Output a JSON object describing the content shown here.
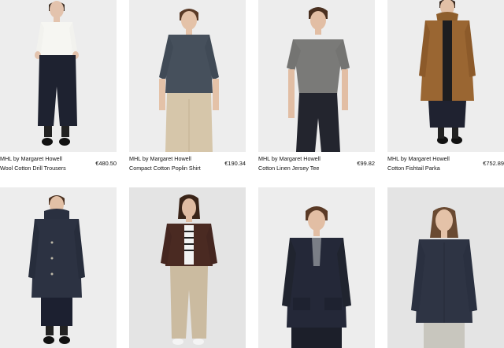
{
  "products": [
    {
      "brand": "MHL by Margaret Howell",
      "name": "Wool Cotton Drill Trousers",
      "price": "€480.50",
      "icon": "model-white-shirt-navy-trousers"
    },
    {
      "brand": "MHL by Margaret Howell",
      "name": "Compact Cotton Poplin Shirt",
      "price": "€190.34",
      "icon": "model-slate-shirt-beige-skirt"
    },
    {
      "brand": "MHL by Margaret Howell",
      "name": "Cotton Linen Jersey Tee",
      "price": "€99.82",
      "icon": "model-grey-tee-navy-trousers"
    },
    {
      "brand": "MHL by Margaret Howell",
      "name": "Cotton Fishtail Parka",
      "price": "€752.89",
      "icon": "model-tan-parka"
    }
  ],
  "second_row": [
    {
      "icon": "model-navy-duffle-coat"
    },
    {
      "icon": "model-brown-jacket-chinos"
    },
    {
      "icon": "model-navy-blazer"
    },
    {
      "icon": "model-navy-overshirt"
    }
  ],
  "colors": {
    "photo_bg": "#ededed",
    "studio_bg_alt": "#e4e4e4",
    "text": "#111111"
  }
}
